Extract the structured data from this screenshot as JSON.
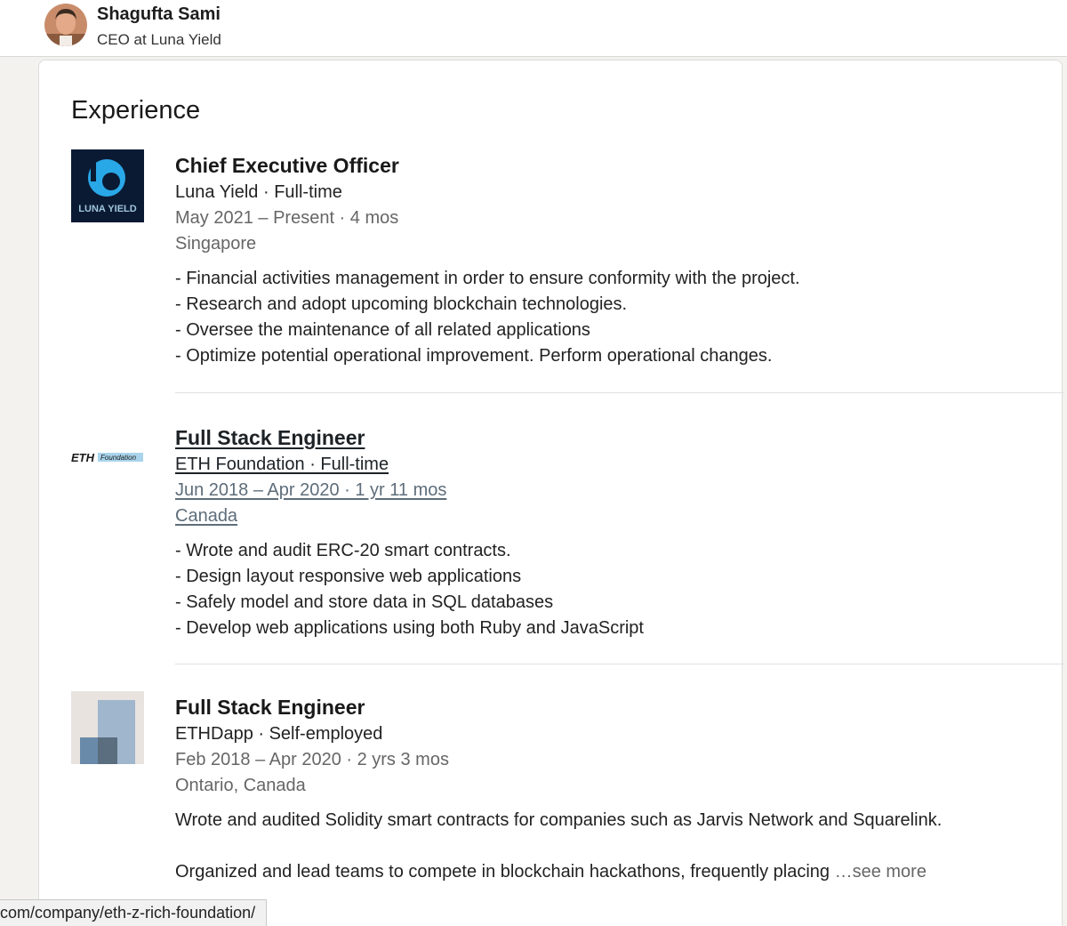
{
  "profile": {
    "name": "Shagufta Sami",
    "headline": "CEO at Luna Yield"
  },
  "section": {
    "title": "Experience"
  },
  "experiences": [
    {
      "role": "Chief Executive Officer",
      "company": "Luna Yield · Full-time",
      "dates": "May 2021 – Present · 4 mos",
      "location": "Singapore",
      "logo_text": "LUNA YIELD",
      "description": [
        "- Financial activities management in order to ensure conformity with the project.",
        "- Research and adopt upcoming blockchain technologies.",
        "- Oversee the maintenance of all related applications",
        "- Optimize potential operational improvement. Perform operational changes."
      ]
    },
    {
      "role": "Full Stack Engineer",
      "company": "ETH Foundation · Full-time",
      "dates": "Jun 2018 – Apr 2020 · 1 yr 11 mos",
      "location": "Canada",
      "logo_text": "ETH",
      "logo_subtext": "Foundation",
      "description": [
        "- Wrote and audit ERC-20 smart contracts.",
        "- Design layout responsive web applications",
        "- Safely model and store data in SQL databases",
        "- Develop web applications using both Ruby and JavaScript"
      ]
    },
    {
      "role": "Full Stack Engineer",
      "company": "ETHDapp · Self-employed",
      "dates": "Feb 2018 – Apr 2020 · 2 yrs 3 mos",
      "location": "Ontario, Canada",
      "description_para1": "Wrote and audited Solidity smart contracts for companies such as Jarvis Network and Squarelink.",
      "description_para2": "Organized and lead teams to compete in blockchain hackathons, frequently placing",
      "see_more": "…see more"
    }
  ],
  "status_bar": {
    "url": "com/company/eth-z-rich-foundation/"
  },
  "colors": {
    "luna_bg": "#0b1a33",
    "luna_accent": "#29a8e8",
    "eth_tag": "#a9d4ec"
  }
}
